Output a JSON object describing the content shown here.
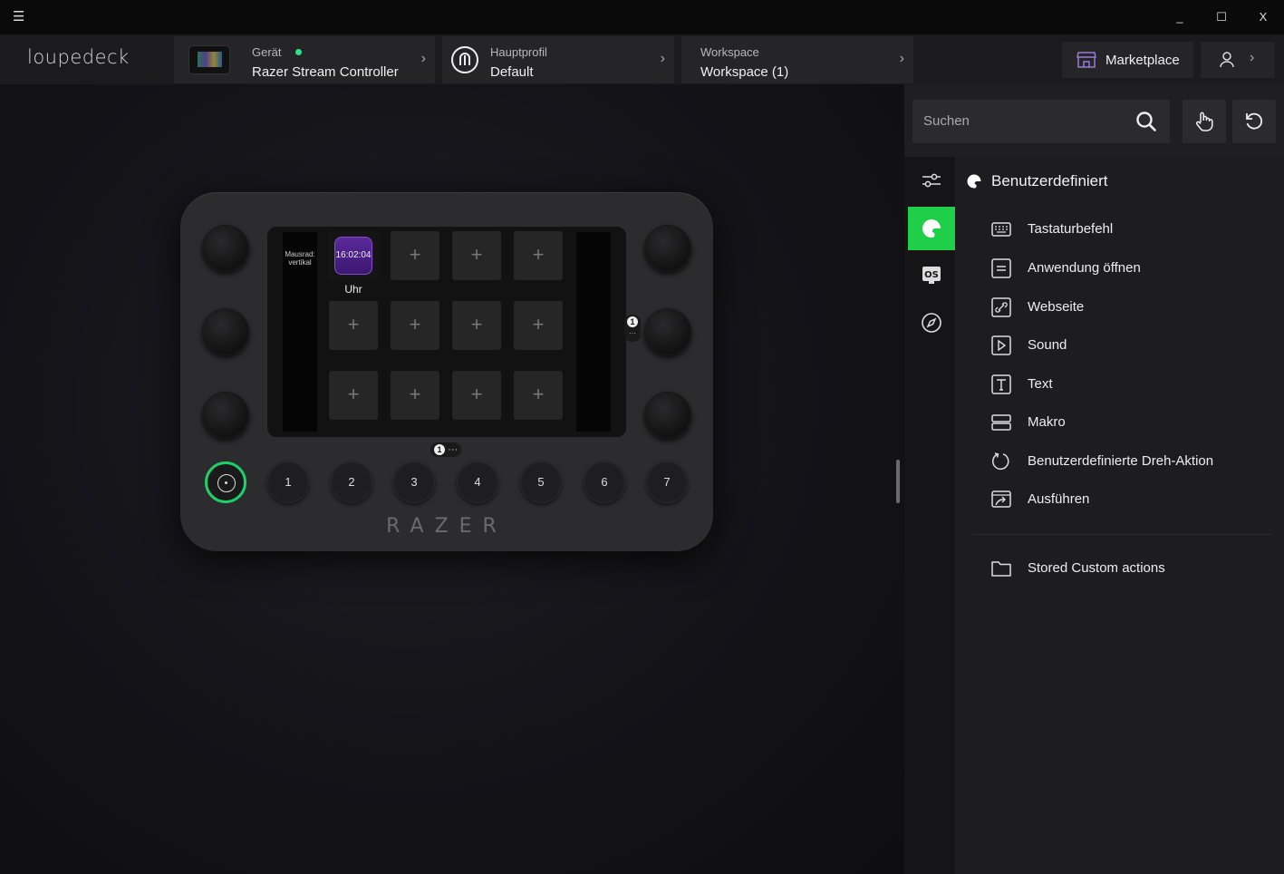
{
  "titlebar": {
    "menu_icon": "☰",
    "minimize": "_",
    "maximize": "☐",
    "close": "X"
  },
  "header": {
    "logo": "LOUPEDECK",
    "device": {
      "label": "Gerät",
      "name": "Razer Stream Controller",
      "status_color": "#2ee08c"
    },
    "profile": {
      "label": "Hauptprofil",
      "name": "Default"
    },
    "workspace": {
      "label": "Workspace",
      "name": "Workspace (1)"
    },
    "marketplace": "Marketplace",
    "chevron": "›"
  },
  "device_view": {
    "strip_left": "Mausrad: vertikal",
    "clock_time": "16:02:04",
    "clock_label": "Uhr",
    "plus": "+",
    "page_right": "1",
    "page_bottom": "1",
    "ellipsis": "···",
    "buttons": [
      "1",
      "2",
      "3",
      "4",
      "5",
      "6",
      "7"
    ],
    "brand": "RAZER",
    "accent": "#1fcf6a"
  },
  "panel": {
    "search_placeholder": "Suchen",
    "category_title": "Benutzerdefiniert",
    "accent": "#1fcf4a",
    "actions": [
      {
        "label": "Tastaturbefehl",
        "icon": "keyboard-icon"
      },
      {
        "label": "Anwendung öffnen",
        "icon": "app-window-icon"
      },
      {
        "label": "Webseite",
        "icon": "link-icon"
      },
      {
        "label": "Sound",
        "icon": "play-icon"
      },
      {
        "label": "Text",
        "icon": "text-icon"
      },
      {
        "label": "Makro",
        "icon": "macro-icon"
      },
      {
        "label": "Benutzerdefinierte Dreh-Aktion",
        "icon": "rotate-icon"
      },
      {
        "label": "Ausführen",
        "icon": "run-icon"
      }
    ],
    "stored": "Stored Custom actions"
  }
}
